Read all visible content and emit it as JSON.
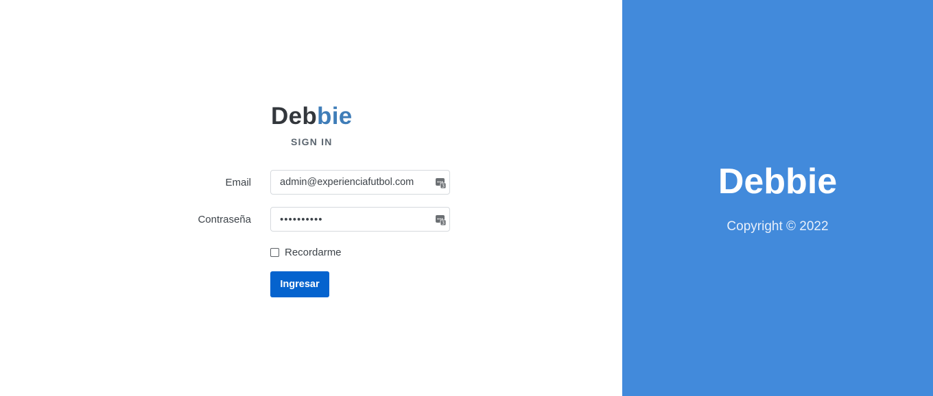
{
  "logo": {
    "part1": "Deb",
    "part2": "bie"
  },
  "heading": "SIGN IN",
  "form": {
    "email_label": "Email",
    "email_value": "admin@experienciafutbol.com",
    "password_label": "Contraseña",
    "password_value": "••••••••••",
    "remember_label": "Recordarme",
    "remember_checked": false,
    "submit_label": "Ingresar"
  },
  "side_panel": {
    "brand": "Debbie",
    "copyright": "Copyright © 2022"
  },
  "colors": {
    "accent_panel": "#428adb",
    "button": "#0563ce",
    "logo_highlight": "#3f7db8"
  },
  "icons": {
    "field_icon": "password-manager-icon"
  }
}
